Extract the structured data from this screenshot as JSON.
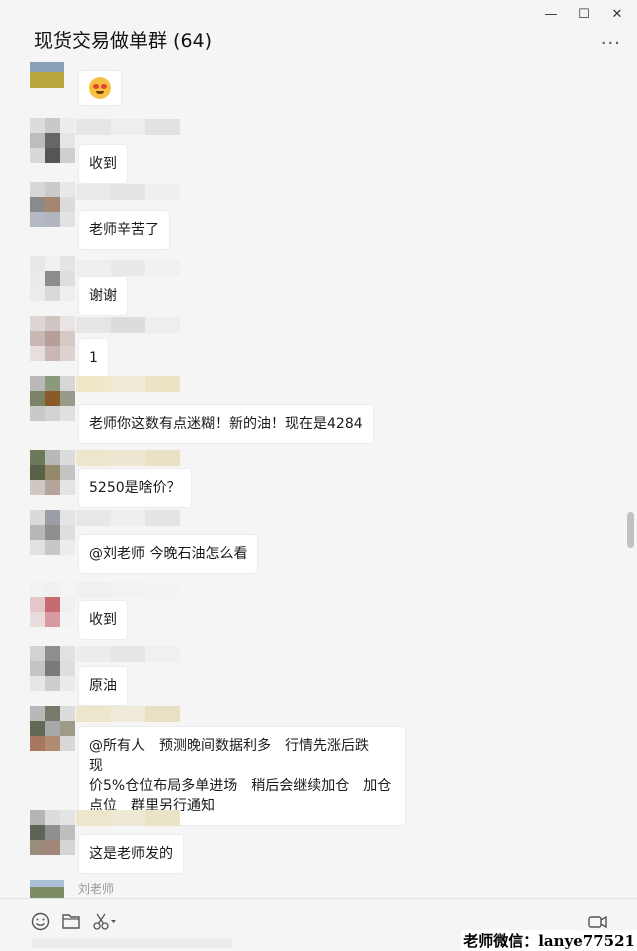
{
  "window": {
    "title": "现货交易做单群 (64)",
    "minimize_glyph": "—",
    "maximize_glyph": "☐",
    "close_glyph": "✕",
    "more_glyph": "···"
  },
  "messages": [
    {
      "type": "emoji",
      "emoji_name": "blushing-smile-emoji"
    },
    {
      "text": "收到"
    },
    {
      "text": "老师辛苦了"
    },
    {
      "text": "谢谢"
    },
    {
      "text": "1"
    },
    {
      "text": "老师你这数有点迷糊！新的油！现在是4284"
    },
    {
      "text": "5250是啥价？"
    },
    {
      "text": "@刘老师 今晚石油怎么看"
    },
    {
      "text": "收到"
    },
    {
      "text": "原油"
    },
    {
      "lines": [
        "@所有人　预测晚间数据利多　行情先涨后跌　现",
        "价5%仓位布局多单进场　稍后会继续加仓　加仓",
        "点位　群里另行通知"
      ]
    },
    {
      "text": "这是老师发的"
    }
  ],
  "last_sender": "刘老师",
  "toolbar": {
    "emoji_icon": "emoji-icon",
    "folder_icon": "folder-icon",
    "scissors_icon": "scissors-icon",
    "video_call_icon": "video-call-icon"
  },
  "watermark": "老师微信：lanye77521"
}
